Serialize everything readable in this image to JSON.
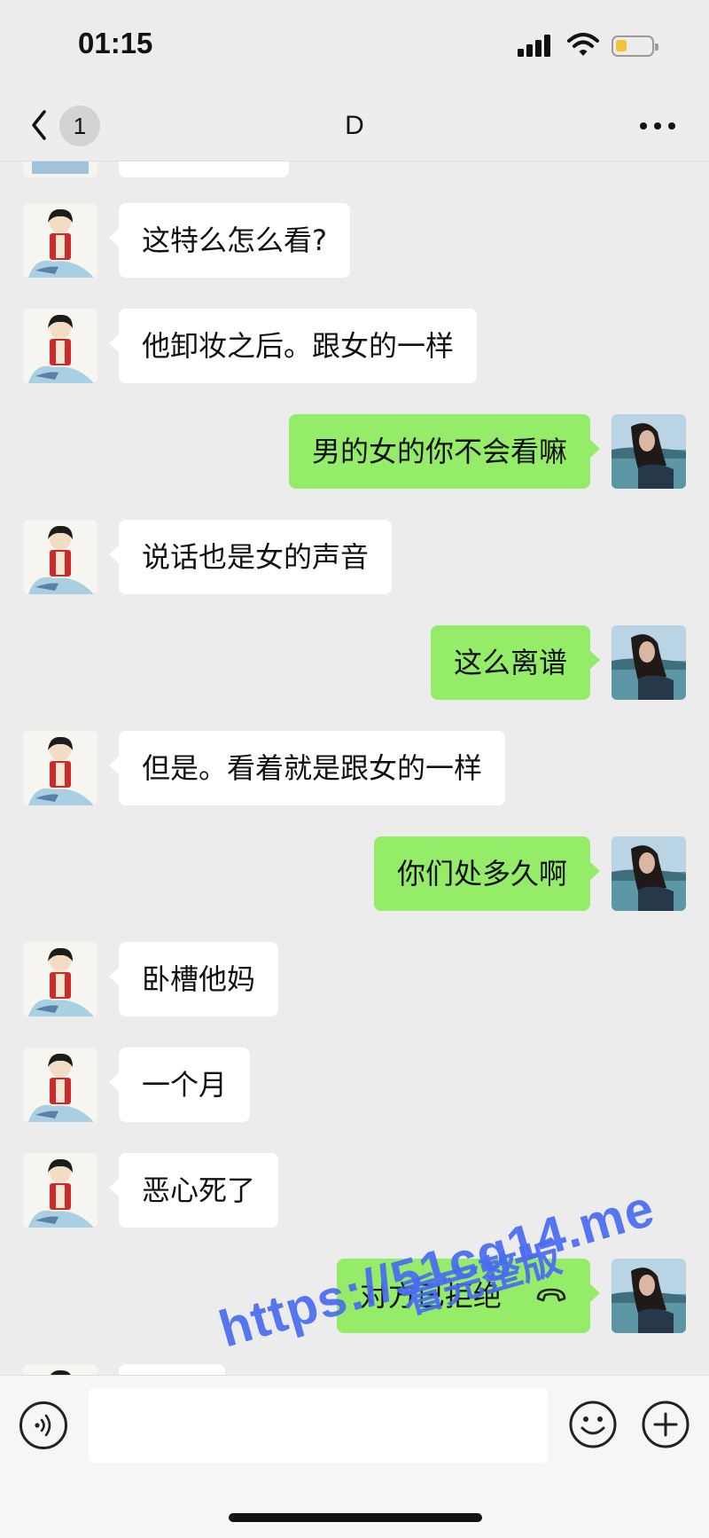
{
  "status_bar": {
    "time": "01:15"
  },
  "nav": {
    "back_badge": "1",
    "title": "D"
  },
  "messages": [
    {
      "side": "left",
      "text": "这特么怎么看?"
    },
    {
      "side": "left",
      "text": "他卸妆之后。跟女的一样"
    },
    {
      "side": "right",
      "text": "男的女的你不会看嘛"
    },
    {
      "side": "left",
      "text": "说话也是女的声音"
    },
    {
      "side": "right",
      "text": "这么离谱"
    },
    {
      "side": "left",
      "text": "但是。看着就是跟女的一样"
    },
    {
      "side": "right",
      "text": "你们处多久啊"
    },
    {
      "side": "left",
      "text": "卧槽他妈"
    },
    {
      "side": "left",
      "text": "一个月"
    },
    {
      "side": "left",
      "text": "恶心死了"
    },
    {
      "side": "right",
      "text": "对方已拒绝",
      "icon": "hangup-phone-icon"
    }
  ],
  "watermark": {
    "line1": "https://51cg14.me",
    "line2": "看完整版"
  },
  "input": {
    "value": ""
  },
  "icons": {
    "back": "chevron-left-icon",
    "more": "more-dots-icon",
    "voice": "voice-input-icon",
    "emoji": "emoji-icon",
    "plus": "plus-circle-icon"
  },
  "colors": {
    "incoming_bubble": "#ffffff",
    "outgoing_bubble": "#95ec69",
    "background": "#ececec",
    "watermark": "#4a6cf2"
  }
}
